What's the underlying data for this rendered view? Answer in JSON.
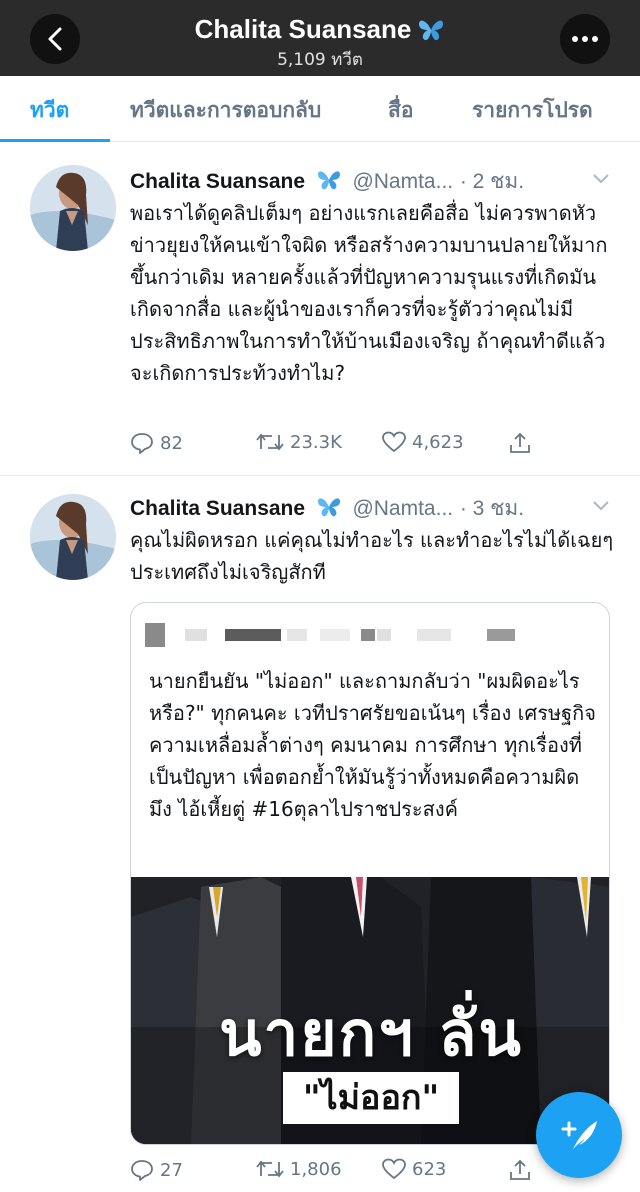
{
  "header": {
    "title": "Chalita Suansane",
    "subtitle": "5,109 ทวีต"
  },
  "tabs": [
    {
      "label": "ทวีต"
    },
    {
      "label": "ทวีตและการตอบกลับ"
    },
    {
      "label": "สื่อ"
    },
    {
      "label": "รายการโปรด"
    }
  ],
  "tweets": [
    {
      "name": "Chalita Suansane",
      "handle": "@Namta...",
      "time": "· 2 ชม.",
      "text": "พอเราได้ดูคลิปเต็มๆ อย่างแรกเลยคือสื่อ ไม่ควรพาดหัวข่าวยุยงให้คนเข้าใจผิด หรือสร้างความบานปลายให้มากขึ้นกว่าเดิม หลายครั้งแล้วที่ปัญหาความรุนแรงที่เกิดมันเกิดจากสื่อ และผู้นำของเราก็ควรที่จะรู้ตัวว่าคุณไม่มีประสิทธิภาพในการทำให้บ้านเมืองเจริญ ถ้าคุณทำดีแล้ว จะเกิดการประท้วงทำไม?",
      "replies": "82",
      "retweets": "23.3K",
      "likes": "4,623"
    },
    {
      "name": "Chalita Suansane",
      "handle": "@Namta...",
      "time": "· 3 ชม.",
      "text": "คุณไม่ผิดหรอก แค่คุณไม่ทำอะไร และทำอะไรไม่ได้เฉยๆ ประเทศถึงไม่เจริญสักที",
      "quote": {
        "text": "นายกยืนยัน \"ไม่ออก\" และถามกลับว่า \"ผมผิดอะไรหรือ?\" ทุกคนคะ เวทีปราศรัยขอเน้นๆ เรื่อง เศรษฐกิจ ความเหลื่อมล้ำต่างๆ คมนาคม การศึกษา ทุกเรื่องที่เป็นปัญหา เพื่อตอกย้ำให้มันรู้ว่าทั้งหมดคือความผิดมึง ไอ้เหี้ยตู่ #16ตุลาไปราชประสงค์",
        "image_title": "นายกฯ ลั่น",
        "image_badge": "\"ไม่ออก\""
      },
      "replies": "27",
      "retweets": "1,806",
      "likes": "623"
    }
  ],
  "colors": {
    "accent": "#1da1f2",
    "header_bg": "#2b2b2b",
    "muted": "#657786"
  }
}
